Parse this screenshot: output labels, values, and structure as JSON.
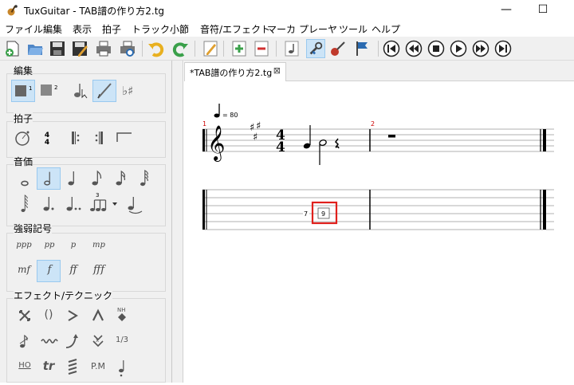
{
  "window": {
    "title": "TuxGuitar - TAB譜の作り方2.tg",
    "minimize": "—",
    "maximize": "☐"
  },
  "menu": [
    "ファイル",
    "編集",
    "表示",
    "拍子",
    "トラック",
    "小節",
    "音符/エフェクト",
    "マーカ",
    "プレーヤ",
    "ツール",
    "ヘルプ"
  ],
  "toolbar": {
    "icons": [
      "new-file",
      "open-file",
      "save-file",
      "save-as",
      "print",
      "print-preview",
      "undo",
      "redo",
      "edit-pencil",
      "add-track",
      "remove-track",
      "note-mode",
      "tools",
      "guitar",
      "marker-flag"
    ],
    "transport": [
      "first",
      "rewind",
      "stop",
      "play",
      "forward",
      "last"
    ]
  },
  "palette": {
    "edit": {
      "label": "編集"
    },
    "time_sig": {
      "label": "拍子",
      "numerator": "4",
      "denominator": "4"
    },
    "duration": {
      "label": "音価",
      "tuplet": "3"
    },
    "dynamics": {
      "label": "強弱記号",
      "items": [
        "ppp",
        "pp",
        "p",
        "mp",
        "mf",
        "f",
        "ff",
        "fff"
      ],
      "selected": "f"
    },
    "effects": {
      "label": "エフェクト/テクニック",
      "items_text": [
        "()",
        "1/3",
        "HO",
        "tr",
        "P.M"
      ]
    }
  },
  "document": {
    "tab_label": "*TAB譜の作り方2.tg",
    "close": "⊠",
    "score": {
      "tempo": "= 80",
      "time_sig_top": "4",
      "time_sig_bottom": "4",
      "measure_numbers": [
        "1",
        "2"
      ],
      "tab_numbers": [
        "7",
        "9"
      ],
      "selected_tab_number": "9",
      "selection_color": "#e0201c"
    }
  }
}
